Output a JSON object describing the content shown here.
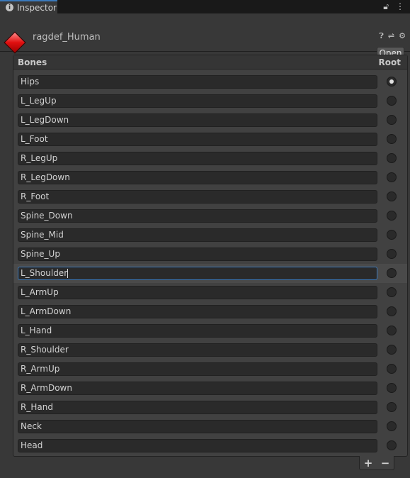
{
  "tab": {
    "label": "Inspector"
  },
  "asset": {
    "name": "ragdef_Human",
    "open_label": "Open"
  },
  "list": {
    "header_bones": "Bones",
    "header_root": "Root",
    "bones": [
      "Hips",
      "L_LegUp",
      "L_LegDown",
      "L_Foot",
      "R_LegUp",
      "R_LegDown",
      "R_Foot",
      "Spine_Down",
      "Spine_Mid",
      "Spine_Up",
      "L_Shoulder",
      "L_ArmUp",
      "L_ArmDown",
      "L_Hand",
      "R_Shoulder",
      "R_ArmUp",
      "R_ArmDown",
      "R_Hand",
      "Neck",
      "Head"
    ],
    "root_index": 0,
    "focused_index": 10,
    "add_label": "+",
    "remove_label": "−"
  },
  "colors": {
    "accent": "#3a79bb",
    "asset_icon": "#e01010"
  }
}
